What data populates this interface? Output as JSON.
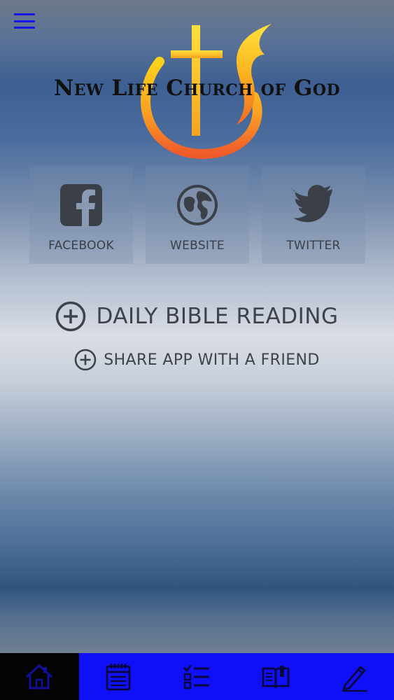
{
  "header": {
    "menu_icon": "hamburger-menu-icon",
    "church_name": "New Life Church of God",
    "logo_icon": "cross-flame-logo"
  },
  "social": [
    {
      "label": "FACEBOOK",
      "icon": "facebook-icon"
    },
    {
      "label": "WEBSITE",
      "icon": "globe-icon"
    },
    {
      "label": "TWITTER",
      "icon": "twitter-icon"
    }
  ],
  "actions": {
    "daily_bible_reading": "DAILY BIBLE READING",
    "share_app": "SHARE APP WITH A FRIEND",
    "icon": "plus-circle-icon"
  },
  "tabbar": {
    "tabs": [
      {
        "icon": "home-icon",
        "active": true
      },
      {
        "icon": "calendar-icon",
        "active": false
      },
      {
        "icon": "checklist-icon",
        "active": false
      },
      {
        "icon": "book-icon",
        "active": false
      },
      {
        "icon": "pencil-icon",
        "active": false
      }
    ]
  },
  "colors": {
    "tabbar_bg": "#1010f8",
    "tabbar_active_bg": "#040404",
    "icon_color": "#3d424b",
    "menu_color": "#1616e6"
  }
}
